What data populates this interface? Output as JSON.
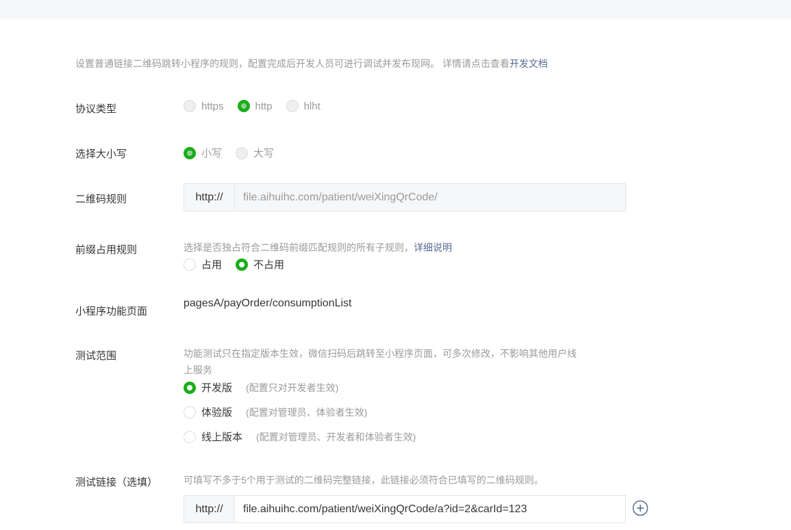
{
  "intro": {
    "text": "设置普通链接二维码跳转小程序的规则，配置完成后开发人员可进行调试并发布现网。 详情请点击查看",
    "link": "开发文档"
  },
  "protocol": {
    "label": "协议类型",
    "options": [
      "https",
      "http",
      "hlht"
    ],
    "selected": "http"
  },
  "case": {
    "label": "选择大小写",
    "options": [
      "小写",
      "大写"
    ],
    "selected": "小写"
  },
  "qr_rule": {
    "label": "二维码规则",
    "prefix": "http://",
    "value": "file.aihuihc.com/patient/weiXingQrCode/"
  },
  "prefix_rule": {
    "label": "前缀占用规则",
    "hint": "选择是否独占符合二维码前缀匹配规则的所有子规则，",
    "hint_link": "详细说明",
    "options": [
      "占用",
      "不占用"
    ],
    "selected": "不占用"
  },
  "page": {
    "label": "小程序功能页面",
    "value": "pagesA/payOrder/consumptionList"
  },
  "test_scope": {
    "label": "测试范围",
    "hint_line1": "功能测试只在指定版本生效，微信扫码后跳转至小程序页面，可多次修改，不影响其他用户线",
    "hint_line2": "上服务",
    "options": [
      {
        "label": "开发版",
        "note": "(配置只对开发者生效)"
      },
      {
        "label": "体验版",
        "note": "(配置对管理员、体验者生效)"
      },
      {
        "label": "线上版本",
        "note": "(配置对管理员、开发者和体验者生效)"
      }
    ],
    "selected": "开发版"
  },
  "test_link": {
    "label": "测试链接（选填）",
    "hint": "可填写不多于5个用于测试的二维码完整链接，此链接必须符合已填写的二维码规则。",
    "prefix": "http://",
    "value": "file.aihuihc.com/patient/weiXingQrCode/a?id=2&carId=123"
  },
  "colors": {
    "accent_green": "#1aad19",
    "link_blue": "#576b95",
    "muted_gray": "#9a9a9a"
  },
  "icons": {
    "add": "plus-circle-icon"
  }
}
